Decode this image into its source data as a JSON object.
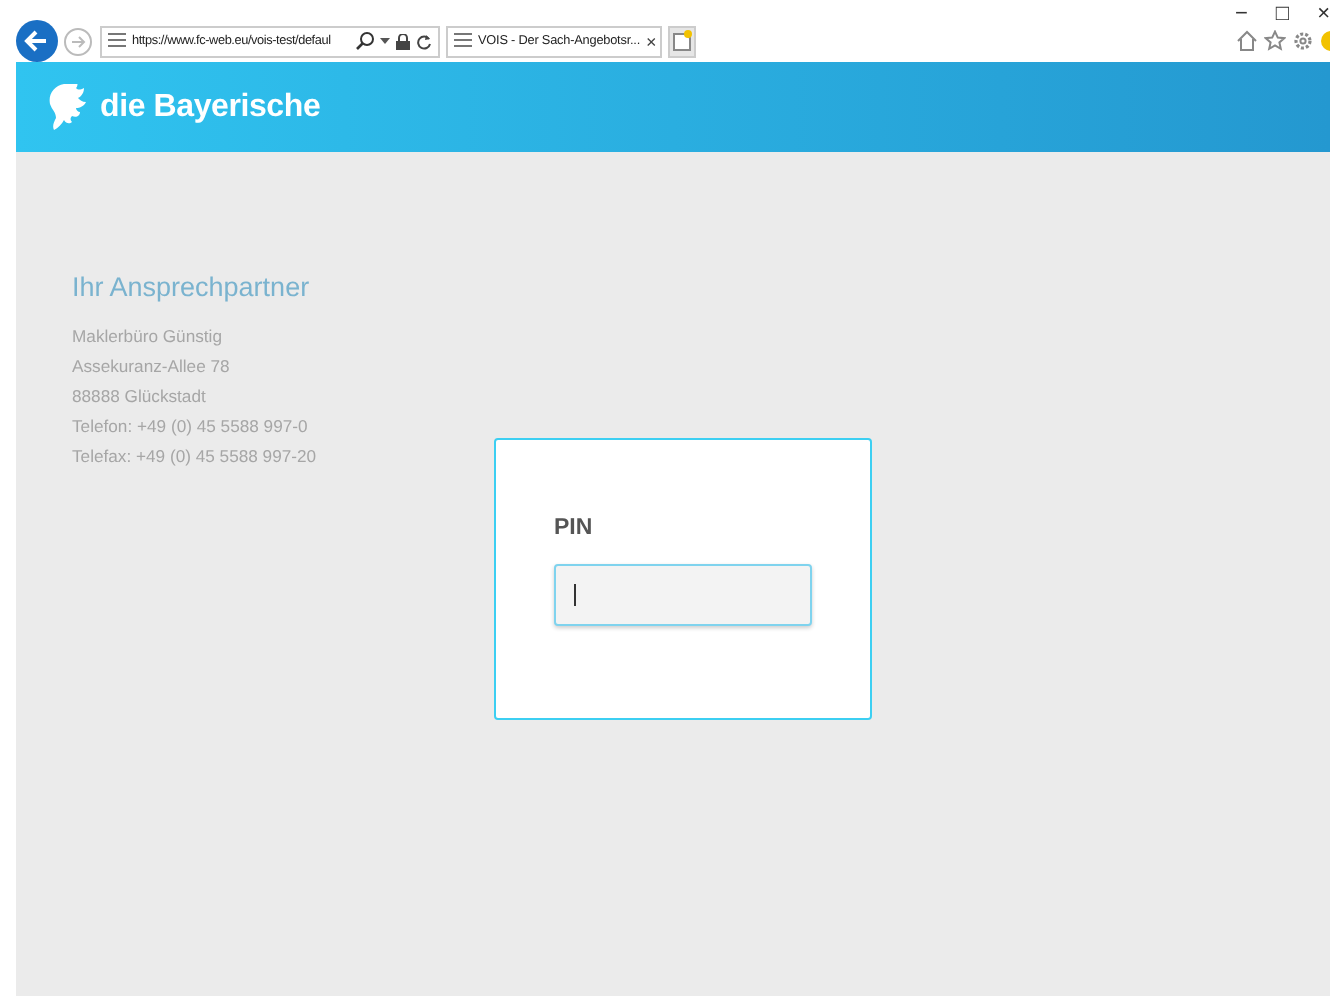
{
  "browser": {
    "address": "https://www.fc-web.eu/vois-test/defaul",
    "tab_title": "VOIS - Der Sach-Angebotsr...",
    "tab_close": "×",
    "window_controls": [
      "−",
      "□",
      "×"
    ]
  },
  "header": {
    "brand": "die Bayerische"
  },
  "contact": {
    "title": "Ihr Ansprechpartner",
    "lines": [
      "Maklerbüro Günstig",
      "Assekuranz-Allee 78",
      "88888 Glückstadt",
      "Telefon: +49 (0) 45 5588 997-0",
      "Telefax: +49 (0) 45 5588 997-20"
    ]
  },
  "login": {
    "label": "PIN",
    "focused": true
  }
}
